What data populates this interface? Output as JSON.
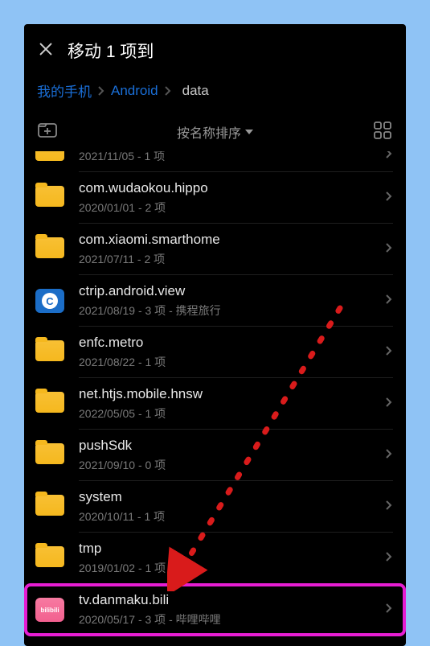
{
  "header": {
    "title": "移动 1 项到"
  },
  "breadcrumb": {
    "root": "我的手机",
    "path1": "Android",
    "current": "data"
  },
  "toolbar": {
    "sort_label": "按名称排序"
  },
  "items": [
    {
      "name": "",
      "meta": "2021/11/05 - 1 项",
      "icon": "folder-yellow",
      "partial": true
    },
    {
      "name": "com.wudaokou.hippo",
      "meta": "2020/01/01 - 2 项",
      "icon": "folder-yellow"
    },
    {
      "name": "com.xiaomi.smarthome",
      "meta": "2021/07/11 - 2 项",
      "icon": "folder-yellow"
    },
    {
      "name": "ctrip.android.view",
      "meta": "2021/08/19 - 3 项 - 携程旅行",
      "icon": "folder-blue"
    },
    {
      "name": "enfc.metro",
      "meta": "2021/08/22 - 1 项",
      "icon": "folder-yellow"
    },
    {
      "name": "net.htjs.mobile.hnsw",
      "meta": "2022/05/05 - 1 项",
      "icon": "folder-yellow"
    },
    {
      "name": "pushSdk",
      "meta": "2021/09/10 - 0 项",
      "icon": "folder-yellow"
    },
    {
      "name": "system",
      "meta": "2020/10/11 - 1 项",
      "icon": "folder-yellow"
    },
    {
      "name": "tmp",
      "meta": "2019/01/02 - 1 项",
      "icon": "folder-yellow"
    },
    {
      "name": "tv.danmaku.bili",
      "meta": "2020/05/17 - 3 项 - 哔哩哔哩",
      "icon": "folder-pink"
    }
  ],
  "icons": {
    "pink_label": "bilibili"
  }
}
